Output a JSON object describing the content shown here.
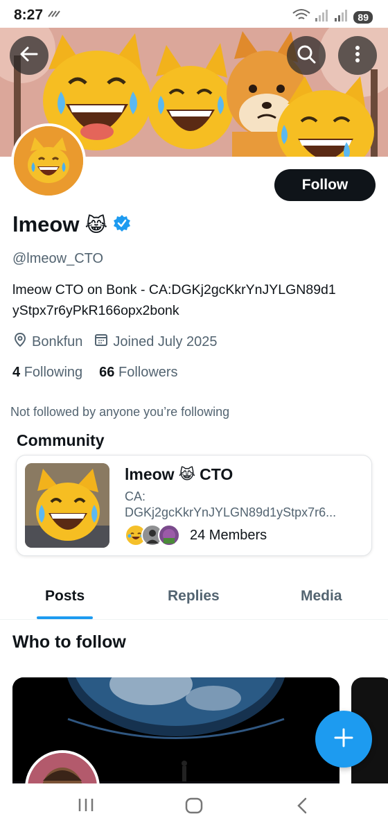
{
  "status_bar": {
    "time": "8:27",
    "battery": "89"
  },
  "profile": {
    "display_name": "lmeow",
    "name_emoji": "😹",
    "handle": "@lmeow_CTO",
    "bio_line1": "lmeow CTO on Bonk - CA:DGKj2gcKkrYnJYLGN89d1",
    "bio_line2": "yStpx7r6yPkR166opx2bonk",
    "location": "Bonkfun",
    "joined": "Joined July 2025",
    "following_count": "4",
    "following_label": "Following",
    "followers_count": "66",
    "followers_label": "Followers",
    "not_followed_text": "Not followed by anyone you’re following",
    "follow_label": "Follow",
    "avatar_emoji": "😹",
    "verified_color": "#1d9bf0"
  },
  "community": {
    "section_title": "Community",
    "name_prefix": "lmeow",
    "name_emoji": "😹",
    "name_suffix": "CTO",
    "desc_line1": "CA:",
    "desc_line2": "DGKj2gcKkrYnJYLGN89d1yStpx7r6...",
    "members": "24 Members"
  },
  "tabs": [
    {
      "label": "Posts",
      "active": true
    },
    {
      "label": "Replies",
      "active": false
    },
    {
      "label": "Media",
      "active": false
    }
  ],
  "who_to_follow": {
    "title": "Who to follow"
  },
  "icons": {
    "back": "arrow-left-icon",
    "search": "search-icon",
    "more": "more-vertical-icon",
    "location": "location-pin-icon",
    "calendar": "calendar-icon",
    "verified": "verified-badge-icon",
    "compose": "plus-icon"
  },
  "colors": {
    "accent": "#1d9bf0",
    "text_primary": "#0f1419",
    "text_secondary": "#536471"
  }
}
